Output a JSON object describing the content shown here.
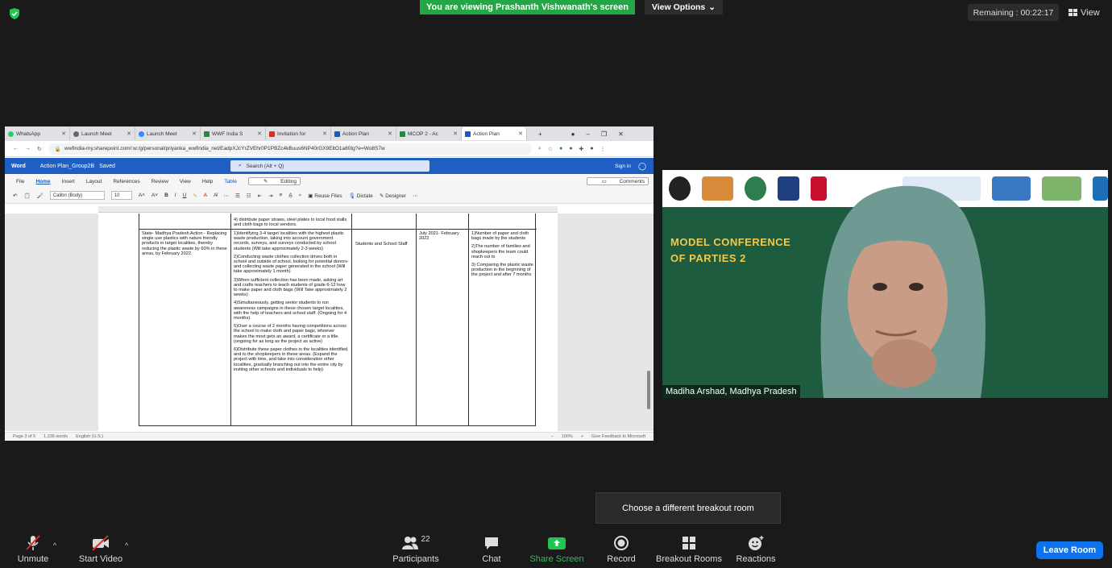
{
  "top": {
    "viewing_banner": "You are viewing Prashanth Vishwanath's screen",
    "view_options": "View Options",
    "remaining": "Remaining : 00:22:17",
    "view_button": "View"
  },
  "browser": {
    "tabs": [
      {
        "label": "WhatsApp",
        "color": "#25d366"
      },
      {
        "label": "Launch Meet",
        "color": "#666666"
      },
      {
        "label": "Launch Meet",
        "color": "#2d8cff"
      },
      {
        "label": "WWF India S",
        "color": "#1e8e3e"
      },
      {
        "label": "Invitation for",
        "color": "#d93025"
      },
      {
        "label": "Action Plan",
        "color": "#185abd"
      },
      {
        "label": "MCOP 2 - Ac",
        "color": "#1e8e3e"
      },
      {
        "label": "Action Plan",
        "color": "#185abd"
      }
    ],
    "url": "wwfindia-my.sharepoint.com/:w:/g/personal/priyanka_wwfindia_net/EadpXJcYrZVEhr0P1PBZc4kBuus6NP40rGX9EltO1a80Ig?e=Wo8S7w"
  },
  "word": {
    "app": "Word",
    "doc_title": "Action Plan_Group2B",
    "saved": "Saved",
    "search": "Search (Alt + Q)",
    "sign_in": "Sign in",
    "ribbon_tabs": [
      "File",
      "Home",
      "Insert",
      "Layout",
      "References",
      "Review",
      "View",
      "Help",
      "Table"
    ],
    "editing": "Editing",
    "comments": "Comments",
    "font": "Calibri (Body)",
    "size": "10",
    "reuse": "Reuse Files",
    "dictate": "Dictate",
    "designer": "Designer",
    "status": {
      "page": "Page 3 of 5",
      "words": "1,235 words",
      "lang": "English (U.S.)",
      "zoom": "100%",
      "feedback": "Give Feedback to Microsoft"
    }
  },
  "table": {
    "top_row_text": "4) distribute paper straws, steel plates to local food stalls and cloth bags to local vendors.",
    "col1": "State- Madhya Pradesh Action - Replacing single use plastics with nature friendly products in target localities, thereby reducing the plastic waste by 60% in these areas, by February 2022.",
    "col2": [
      "1)Identifying 3-4 target localities with the highest plastic waste production, taking into account government records, surveys, and surveys conducted by school students (Will take approximately 2-3 weeks)",
      "2)Conducting waste clothes collection drives both in school and outside of school, looking for potential donors- and collecting waste paper generated in the school (Will take approximately 1 month)",
      "3)When sufficient collection has been made, asking art and crafts teachers to teach students of grade 6-12 how to make paper and cloth bags (Will Take approximately 2 weeks)",
      "4)Simultaneously, getting senior students to run awareness campaigns in these chosen target localities, with the help of teachers and school staff. (Ongoing for 4 months)",
      "5)Over a course of 2 months having competitions across the school to make cloth and paper bags, whoever makes the most gets an award, a certificate or a title. (ongoing for as long as the project as active)",
      "6)Distribute these paper clothes in the localities identified, and to the shopkeepers in these areas. (Expand the project with time, and take into consideration other localities, gradually branching out into the entire city by inviting other schools and individuals to help)"
    ],
    "col3": "Students and School Staff",
    "col4": "July 2021- February 2022",
    "col5": [
      "1)Number of paper and cloth bags made by the students",
      "2)The number of families and shopkeepers the team could reach out to",
      "3) Comparing the plastic waste production in the beginning of the project and after 7 months"
    ]
  },
  "video": {
    "conference_title": [
      "MODEL CONFERENCE",
      "OF PARTIES 2"
    ],
    "participant_name": "Madiha Arshad, Madhya Pradesh"
  },
  "tooltip": "Choose a different breakout room",
  "toolbar": {
    "unmute": "Unmute",
    "start_video": "Start Video",
    "participants": "Participants",
    "participants_count": "22",
    "chat": "Chat",
    "share_screen": "Share Screen",
    "record": "Record",
    "breakout_rooms": "Breakout Rooms",
    "reactions": "Reactions",
    "leave": "Leave Room"
  }
}
